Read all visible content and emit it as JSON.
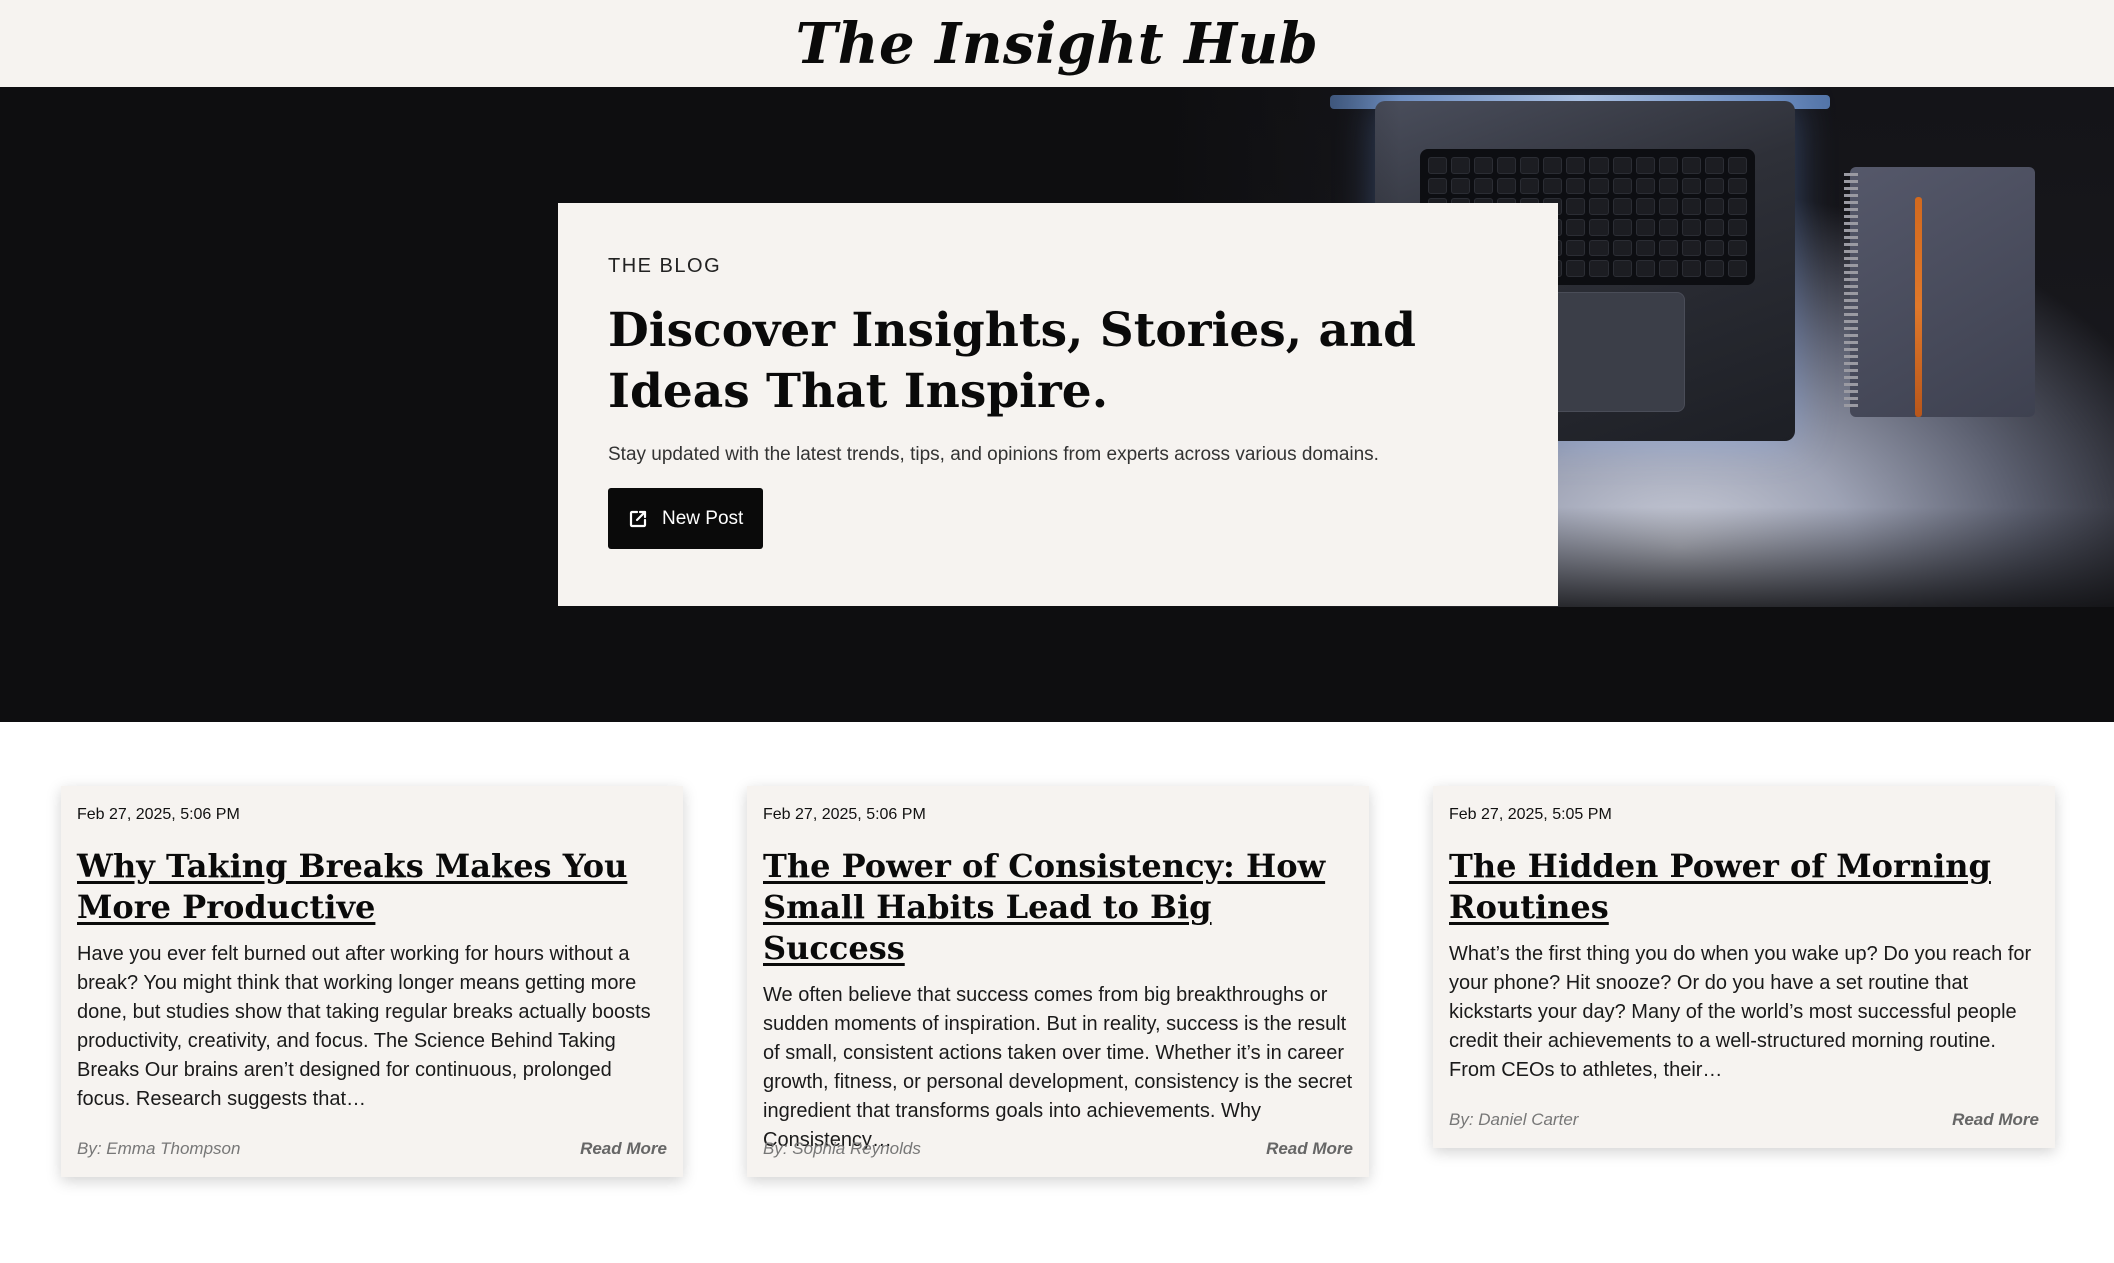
{
  "site": {
    "title": "The Insight Hub"
  },
  "hero": {
    "kicker": "THE BLOG",
    "heading": "Discover Insights, Stories, and Ideas That Inspire.",
    "subheading": "Stay updated with the latest trends, tips, and opinions from experts across various domains.",
    "button_label": "New Post",
    "button_icon": "external-link-icon"
  },
  "posts": [
    {
      "date": "Feb 27, 2025, 5:06 PM",
      "title": "Why Taking Breaks Makes You More Productive",
      "excerpt": "Have you ever felt burned out after working for hours without a break? You might think that working longer means getting more done, but studies show that taking regular breaks actually boosts productivity, creativity, and focus. The Science Behind Taking Breaks Our brains aren’t designed for continuous, prolonged focus. Research suggests that…",
      "author": "By: Emma Thompson",
      "read_more": "Read More"
    },
    {
      "date": "Feb 27, 2025, 5:06 PM",
      "title": "The Power of Consistency: How Small Habits Lead to Big Success",
      "excerpt": "We often believe that success comes from big breakthroughs or sudden moments of inspiration. But in reality, success is the result of small, consistent actions taken over time. Whether it’s in career growth, fitness, or personal development, consistency is the secret ingredient that transforms goals into achievements. Why Consistency…",
      "author": "By: Sophia Reynolds",
      "read_more": "Read More"
    },
    {
      "date": "Feb 27, 2025, 5:05 PM",
      "title": "The Hidden Power of Morning Routines",
      "excerpt": "What’s the first thing you do when you wake up? Do you reach for your phone? Hit snooze? Or do you have a set routine that kickstarts your day? Many of the world’s most successful people credit their achievements to a well-structured morning routine. From CEOs to athletes, their…",
      "author": "By: Daniel Carter",
      "read_more": "Read More"
    }
  ]
}
